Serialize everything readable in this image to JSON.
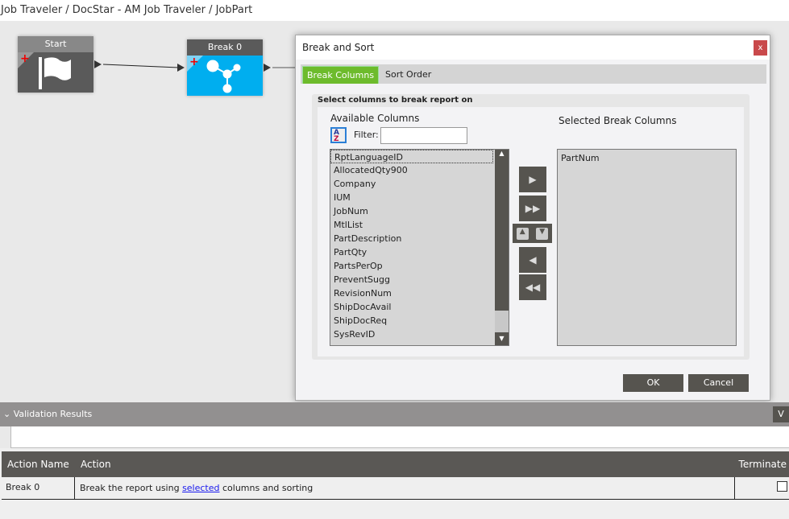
{
  "breadcrumb": "Job Traveler / DocStar - AM Job Traveler / JobPart",
  "nodes": [
    {
      "label": "Start",
      "icon": "flag-icon"
    },
    {
      "label": "Break 0",
      "icon": "break-node-icon"
    }
  ],
  "dialog": {
    "title": "Break and Sort",
    "close": "x",
    "tabs": [
      "Break Columns",
      "Sort Order"
    ],
    "group_label": "Select columns to break report on",
    "available_label": "Available Columns",
    "filter_label": "Filter:",
    "filter_value": "",
    "available": [
      "RptLanguageID",
      "AllocatedQty900",
      "Company",
      "IUM",
      "JobNum",
      "MtlList",
      "PartDescription",
      "PartQty",
      "PartsPerOp",
      "PreventSugg",
      "RevisionNum",
      "ShipDocAvail",
      "ShipDocReq",
      "SysRevID"
    ],
    "selected_label": "Selected Break Columns",
    "selected": [
      "PartNum"
    ],
    "ok": "OK",
    "cancel": "Cancel"
  },
  "validation": {
    "title": "Validation Results",
    "right_button": "V",
    "headers": [
      "Action Name",
      "Action",
      "Terminate"
    ],
    "rows": [
      {
        "name": "Break 0",
        "action_pre": "Break the report using ",
        "action_link": "selected",
        "action_post": " columns and sorting",
        "terminate": false
      }
    ]
  },
  "colors": {
    "accent_tab": "#6dbb2c",
    "node_blue": "#00aeef",
    "dark": "#56544f",
    "close": "#c9494b"
  }
}
